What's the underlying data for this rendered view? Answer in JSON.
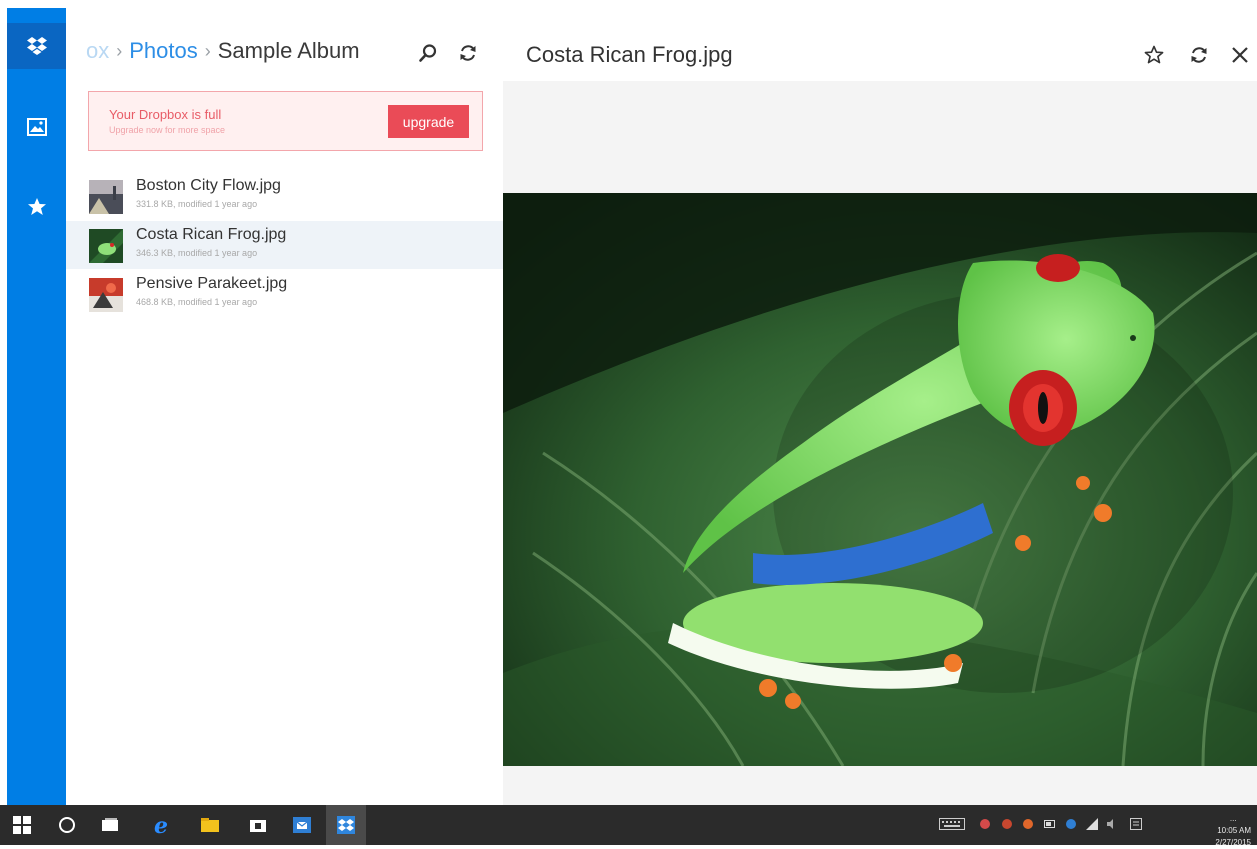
{
  "nav": {
    "items": [
      {
        "name": "dropbox-icon",
        "active": true
      },
      {
        "name": "photos-icon",
        "active": false
      },
      {
        "name": "favorites-star-icon",
        "active": false
      }
    ]
  },
  "breadcrumb": {
    "faded": "ox",
    "photos": "Photos",
    "current": "Sample Album",
    "separator": "›"
  },
  "banner": {
    "title": "Your Dropbox is full",
    "subtitle": "Upgrade now for more space",
    "button": "upgrade"
  },
  "files": [
    {
      "name": "Boston City Flow.jpg",
      "meta": "331.8 KB, modified 1 year ago",
      "selected": false
    },
    {
      "name": "Costa Rican Frog.jpg",
      "meta": "346.3 KB, modified 1 year ago",
      "selected": true
    },
    {
      "name": "Pensive Parakeet.jpg",
      "meta": "468.8 KB, modified 1 year ago",
      "selected": false
    }
  ],
  "viewer": {
    "title": "Costa Rican Frog.jpg"
  },
  "taskbar": {
    "time": "10:05 AM",
    "date": "2/27/2015",
    "more": "..."
  },
  "colors": {
    "accent": "#007ee5",
    "link": "#2d8ee6",
    "warning": "#ea4b57",
    "taskbar": "#2b2b2b"
  }
}
